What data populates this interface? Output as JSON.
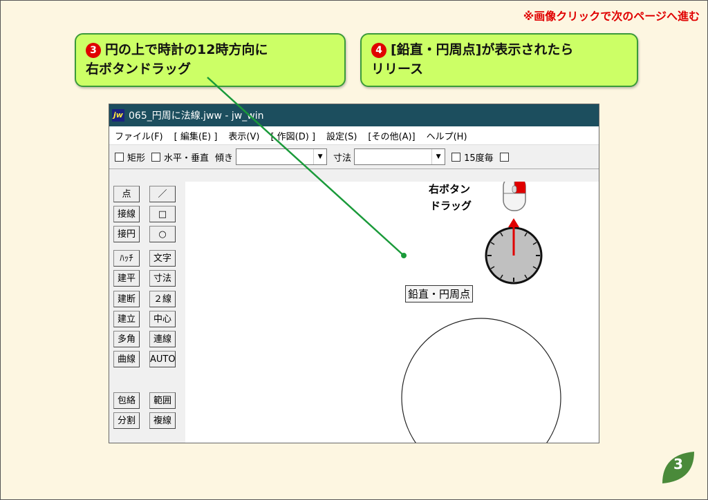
{
  "top_note": "※画像クリックで次のページへ進む",
  "callouts": [
    {
      "num": "3",
      "line1": "円の上で時計の12時方向に",
      "line2": "右ボタンドラッグ"
    },
    {
      "num": "4",
      "line1": "[鉛直・円周点]が表示されたら",
      "line2": "リリース"
    }
  ],
  "window": {
    "title": "065_円周に法線.jww - jw_win",
    "icon_text": "jw",
    "menu": [
      "ファイル(F)",
      "[ 編集(E) ]",
      "表示(V)",
      "[ 作図(D) ]",
      "設定(S)",
      "[その他(A)]",
      "ヘルプ(H)"
    ],
    "toolbar": {
      "rect_label": "矩形",
      "hv_label": "水平・垂直",
      "tilt_label": "傾き",
      "dim_label": "寸法",
      "deg15_label": "15度毎"
    },
    "left_tools": [
      [
        "点",
        "／"
      ],
      [
        "接線",
        "□"
      ],
      [
        "接円",
        "○"
      ],
      [
        "ﾊｯﾁ",
        "文字"
      ],
      [
        "建平",
        "寸法"
      ],
      [
        "建断",
        "２線"
      ],
      [
        "建立",
        "中心線"
      ],
      [
        "多角形",
        "連線"
      ],
      [
        "曲線",
        "AUTO"
      ],
      [
        "包絡",
        "範囲"
      ],
      [
        "分割",
        "複線"
      ]
    ]
  },
  "tooltip": "鉛直・円周点",
  "drag_label": {
    "line1": "右ボタン",
    "line2": "ドラッグ"
  },
  "page_number": "3",
  "colors": {
    "accent_red": "#e00000",
    "callout_bg": "#ccff66",
    "callout_border": "#3a9a3a",
    "titlebar": "#1c4e5e",
    "leader_line": "#1a9a3a",
    "page_leaf": "#4a8a3a"
  }
}
